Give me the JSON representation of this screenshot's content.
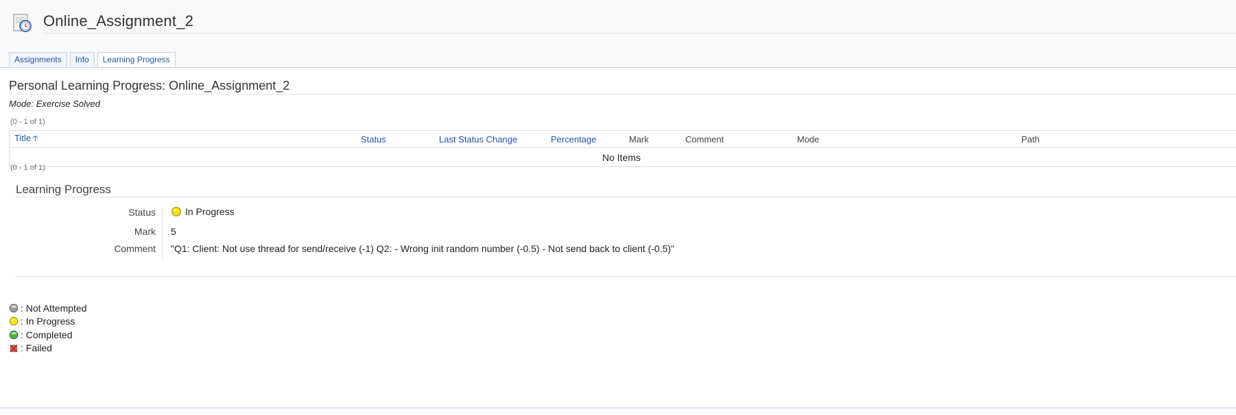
{
  "header": {
    "title": "Online_Assignment_2",
    "icon": "exercise-icon"
  },
  "tabs": [
    {
      "label": "Assignments",
      "active": false
    },
    {
      "label": "Info",
      "active": false
    },
    {
      "label": "Learning Progress",
      "active": true
    }
  ],
  "personal": {
    "title": "Personal Learning Progress: Online_Assignment_2",
    "mode": "Mode: Exercise Solved",
    "pager_top": "(0 - 1 of 1)",
    "pager_bottom": "(0 - 1 of 1)"
  },
  "table": {
    "columns": [
      {
        "label": "Title",
        "sortable": true,
        "sorted": "asc"
      },
      {
        "label": "Status",
        "sortable": true
      },
      {
        "label": "Last Status Change",
        "sortable": true
      },
      {
        "label": "Percentage",
        "sortable": true
      },
      {
        "label": "Mark",
        "sortable": false
      },
      {
        "label": "Comment",
        "sortable": false
      },
      {
        "label": "Mode",
        "sortable": false
      },
      {
        "label": "Path",
        "sortable": false
      }
    ],
    "empty_text": "No Items"
  },
  "learning_progress": {
    "title": "Learning Progress",
    "status_label": "Status",
    "status_value": "In Progress",
    "mark_label": "Mark",
    "mark_value": "5",
    "comment_label": "Comment",
    "comment_value": "\"Q1: Client: Not use thread for send/receive (-1) Q2: - Wrong init random number (-0.5) - Not send back to client (-0.5)\""
  },
  "legend": [
    {
      "label": ": Not Attempted",
      "icon": "not-attempted-icon",
      "color": "#9a9a9a"
    },
    {
      "label": ": In Progress",
      "icon": "in-progress-icon",
      "color": "#f5e400"
    },
    {
      "label": ": Completed",
      "icon": "completed-icon",
      "color": "#3fb83a"
    },
    {
      "label": ": Failed",
      "icon": "failed-icon",
      "color": "#e0261d"
    }
  ],
  "colors": {
    "link": "#2255a4",
    "tab_border": "#c4d2e5"
  }
}
